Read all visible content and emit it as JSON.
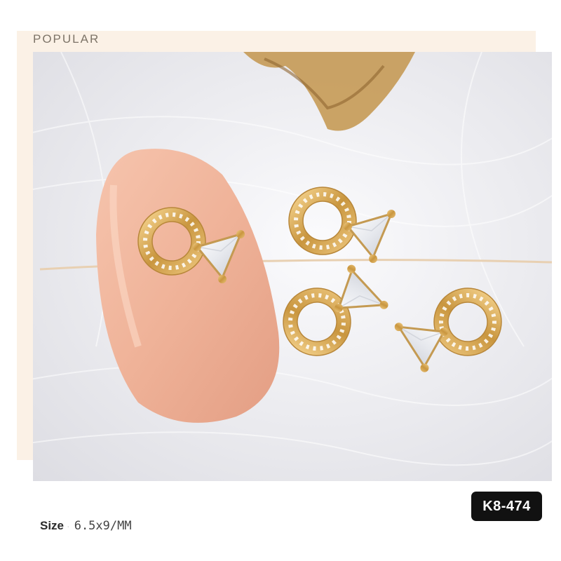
{
  "header": {
    "label": "POPULAR"
  },
  "photo": {
    "subject": "gold zircon nail charms: open pave circle with triangle crystal, on a nude pink nail tip and white feathers",
    "colors": {
      "nail": "#f0b49b",
      "gold": "#d7a853",
      "feather": "#eeeef2",
      "crystal": "#ffffff"
    }
  },
  "product": {
    "code": "K8-474",
    "size_label": "Size",
    "size_value": "6.5x9/MM"
  }
}
